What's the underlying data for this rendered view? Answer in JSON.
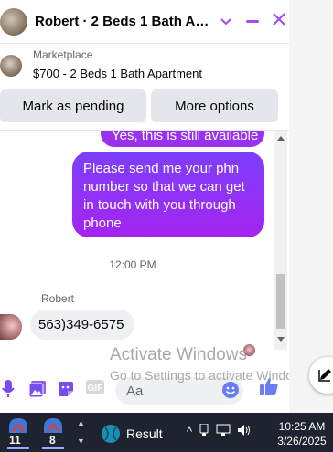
{
  "header": {
    "title": "Robert · 2 Beds 1 Bath Apa...",
    "accent": "#a24ef0"
  },
  "listing": {
    "label": "Marketplace",
    "title": "$700 - 2 Beds 1 Bath Apartment"
  },
  "actions": {
    "pending_label": "Mark as pending",
    "more_label": "More options"
  },
  "messages": {
    "outgoing_partial": "Yes, this is still available",
    "outgoing_main": "Please send me your phn number so that we can get in touch with you through phone",
    "timestamp": "12:00 PM",
    "sender_name": "Robert",
    "incoming": "563)349-6575"
  },
  "composer": {
    "placeholder": "Aa"
  },
  "watermark": {
    "line1": "Activate Windows",
    "line2": "Go to Settings to activate Windows."
  },
  "taskbar": {
    "badge_1": "11",
    "badge_2": "8",
    "result_label": "Result",
    "time": "10:25 AM",
    "date": "3/26/2025"
  }
}
